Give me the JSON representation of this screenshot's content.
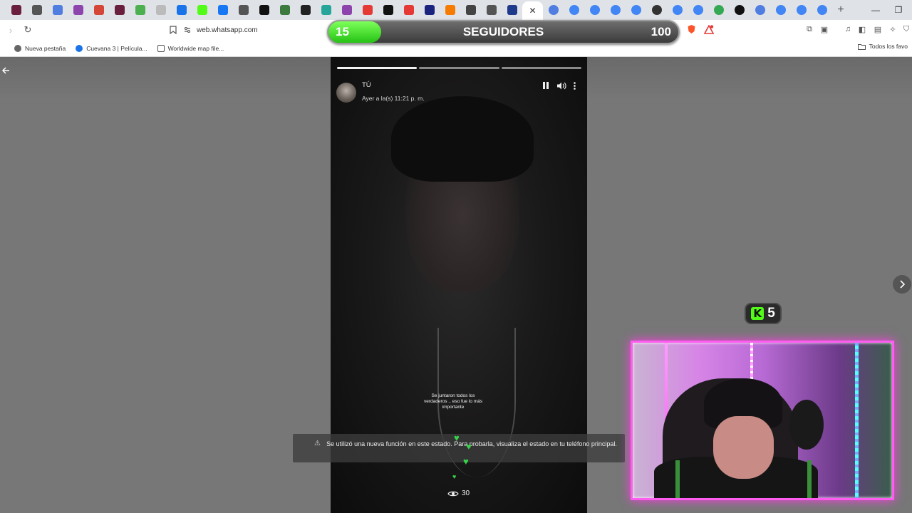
{
  "browser": {
    "tab_icon_colors": [
      "#6b1f3f",
      "#555555",
      "#4f7de0",
      "#8e44ad",
      "#d44638",
      "#6b1f3f",
      "#4caf50",
      "#bbbbbb",
      "#1a73e8",
      "#53fc18",
      "#1877f2",
      "#555555",
      "#111111",
      "#3d7a3d",
      "#222222",
      "#26a69a",
      "#8e44ad",
      "#e53935",
      "#111111",
      "#e53935",
      "#1a237e",
      "#f57c00",
      "#444444",
      "#555555",
      "#1e3a8a"
    ],
    "tab_close_glyph": "✕",
    "new_tab_glyph": "+",
    "trailing_tab_icons": [
      "#4f7de0",
      "#4285f4",
      "#4285f4",
      "#4285f4",
      "#4285f4",
      "#333333",
      "#4285f4",
      "#4285f4",
      "#34a853",
      "#111111",
      "#4f7de0",
      "#4285f4",
      "#4285f4",
      "#4285f4"
    ],
    "window_controls": [
      "—",
      "❐"
    ],
    "url": "web.whatsapp.com",
    "bookmarks": [
      {
        "label": "Nueva pestaña",
        "color": "#555555"
      },
      {
        "label": "Cuevana 3 | Película...",
        "color": "#1a73e8"
      },
      {
        "label": "Worldwide map file...",
        "color": "#555555"
      }
    ],
    "bookmarks_right": "Todos los favo"
  },
  "followers": {
    "count": "15",
    "title": "SEGUIDORES",
    "goal": "100",
    "progress": 0.15
  },
  "story": {
    "user": "TÚ",
    "timestamp": "Ayer a la(s) 11:21 p. m.",
    "segments": 3,
    "segments_done": 1,
    "caption": "Se juntaron todos los verdaderos .. eso fue lo más importante",
    "notice": "Se utilizó una nueva función en este estado. Para probarla, visualiza el estado en tu teléfono principal.",
    "views": "30"
  },
  "kick": {
    "letter": "K",
    "count": "5"
  }
}
